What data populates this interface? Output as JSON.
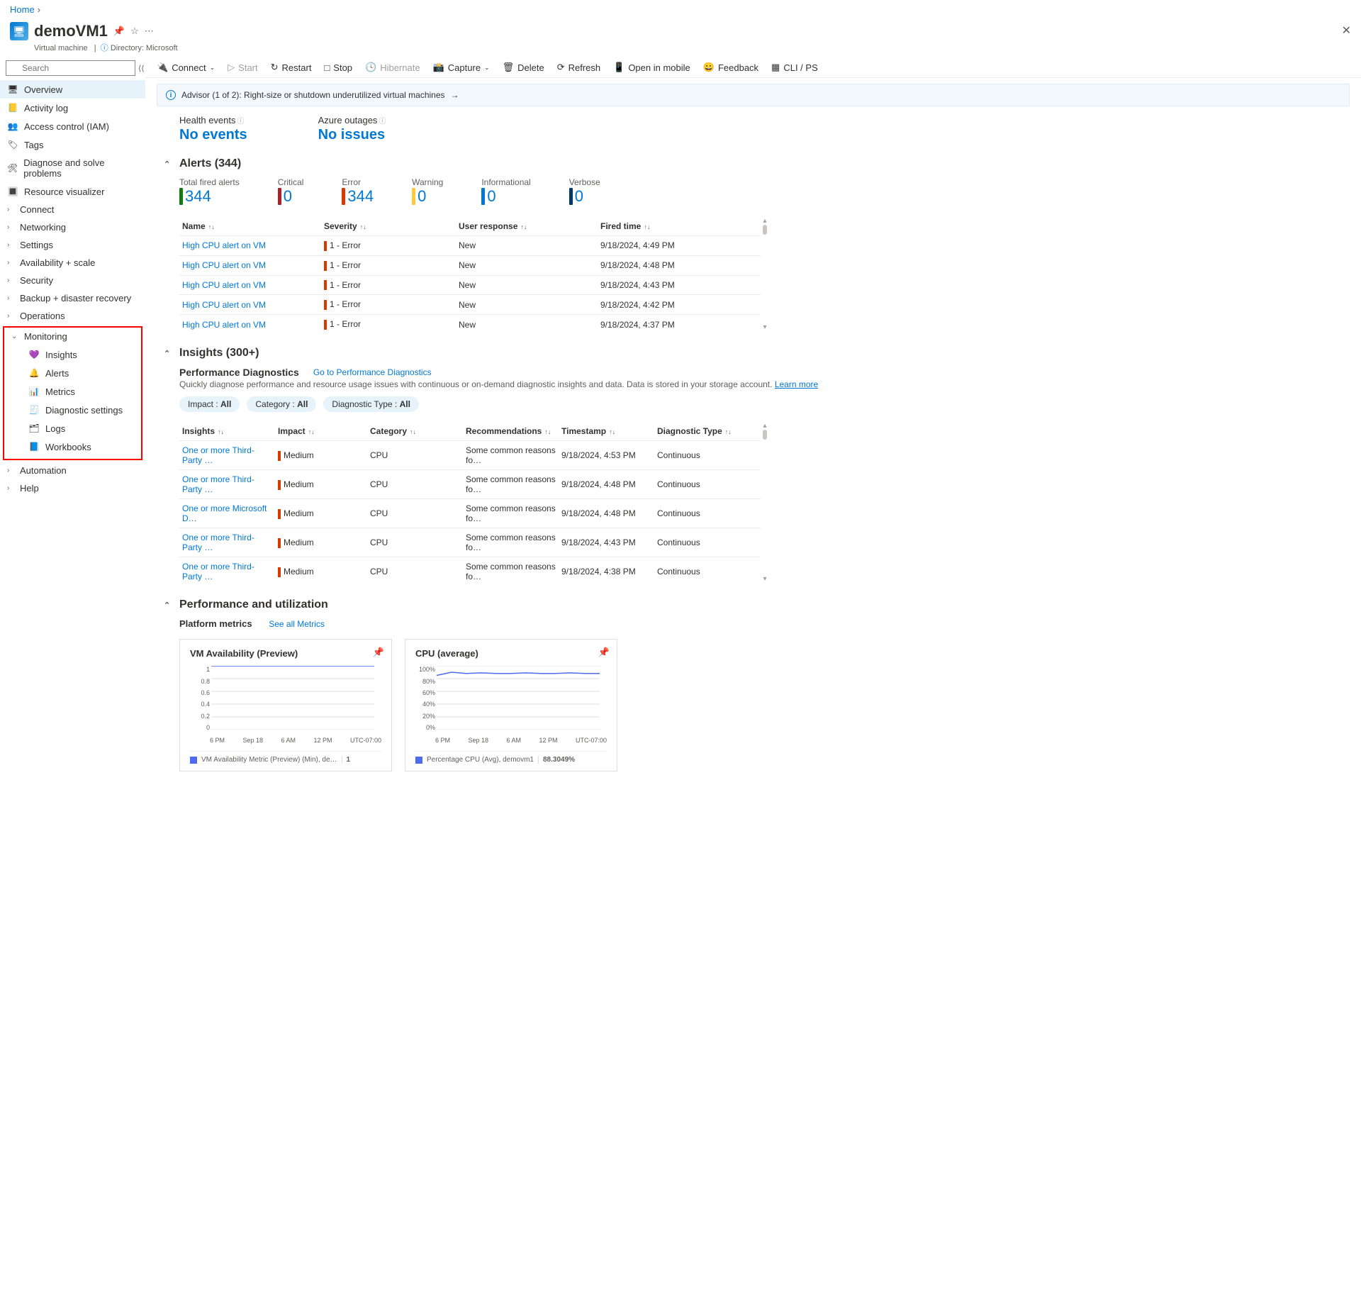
{
  "breadcrumb": {
    "home": "Home"
  },
  "header": {
    "title": "demoVM1",
    "subtitle": "Virtual machine",
    "directory_label": "Directory: Microsoft"
  },
  "sidebar": {
    "search_placeholder": "Search",
    "items_top": [
      {
        "label": "Overview",
        "selected": true,
        "icon": "🖥"
      },
      {
        "label": "Activity log",
        "icon": "📒"
      },
      {
        "label": "Access control (IAM)",
        "icon": "👥"
      },
      {
        "label": "Tags",
        "icon": "🏷"
      },
      {
        "label": "Diagnose and solve problems",
        "icon": "🛠"
      },
      {
        "label": "Resource visualizer",
        "icon": "🔳"
      }
    ],
    "items_chev": [
      {
        "label": "Connect"
      },
      {
        "label": "Networking"
      },
      {
        "label": "Settings"
      },
      {
        "label": "Availability + scale"
      },
      {
        "label": "Security"
      },
      {
        "label": "Backup + disaster recovery"
      },
      {
        "label": "Operations"
      }
    ],
    "monitoring_label": "Monitoring",
    "monitoring_items": [
      {
        "label": "Insights",
        "icon": "💜"
      },
      {
        "label": "Alerts",
        "icon": "🔔"
      },
      {
        "label": "Metrics",
        "icon": "📊"
      },
      {
        "label": "Diagnostic settings",
        "icon": "🧾"
      },
      {
        "label": "Logs",
        "icon": "🗂"
      },
      {
        "label": "Workbooks",
        "icon": "📘"
      }
    ],
    "automation": "Automation",
    "help": "Help"
  },
  "toolbar": {
    "connect": "Connect",
    "start": "Start",
    "restart": "Restart",
    "stop": "Stop",
    "hibernate": "Hibernate",
    "capture": "Capture",
    "delete": "Delete",
    "refresh": "Refresh",
    "open_mobile": "Open in mobile",
    "feedback": "Feedback",
    "cli": "CLI / PS"
  },
  "advisor": "Advisor (1 of 2): Right-size or shutdown underutilized virtual machines",
  "health": {
    "events_label": "Health events",
    "events_value": "No events",
    "azure_label": "Azure outages",
    "azure_value": "No issues"
  },
  "alerts": {
    "header": "Alerts (344)",
    "summary": [
      {
        "label": "Total fired alerts",
        "value": "344",
        "cls": "total"
      },
      {
        "label": "Critical",
        "value": "0",
        "cls": "crit"
      },
      {
        "label": "Error",
        "value": "344",
        "cls": "err"
      },
      {
        "label": "Warning",
        "value": "0",
        "cls": "warn"
      },
      {
        "label": "Informational",
        "value": "0",
        "cls": "info"
      },
      {
        "label": "Verbose",
        "value": "0",
        "cls": "verb"
      }
    ],
    "cols": {
      "name": "Name",
      "severity": "Severity",
      "user": "User response",
      "time": "Fired time"
    },
    "rows": [
      {
        "name": "High CPU alert on VM",
        "sev": "1 - Error",
        "user": "New",
        "time": "9/18/2024, 4:49 PM"
      },
      {
        "name": "High CPU alert on VM",
        "sev": "1 - Error",
        "user": "New",
        "time": "9/18/2024, 4:48 PM"
      },
      {
        "name": "High CPU alert on VM",
        "sev": "1 - Error",
        "user": "New",
        "time": "9/18/2024, 4:43 PM"
      },
      {
        "name": "High CPU alert on VM",
        "sev": "1 - Error",
        "user": "New",
        "time": "9/18/2024, 4:42 PM"
      },
      {
        "name": "High CPU alert on VM",
        "sev": "1 - Error",
        "user": "New",
        "time": "9/18/2024, 4:37 PM"
      }
    ]
  },
  "insights": {
    "header": "Insights (300+)",
    "perf_title": "Performance Diagnostics",
    "perf_link": "Go to Performance Diagnostics",
    "perf_desc": "Quickly diagnose performance and resource usage issues with continuous or on-demand diagnostic insights and data. Data is stored in your storage account.",
    "learn_more": "Learn more",
    "pills": [
      {
        "prefix": "Impact : ",
        "val": "All"
      },
      {
        "prefix": "Category : ",
        "val": "All"
      },
      {
        "prefix": "Diagnostic Type : ",
        "val": "All"
      }
    ],
    "cols": {
      "insights": "Insights",
      "impact": "Impact",
      "category": "Category",
      "rec": "Recommendations",
      "ts": "Timestamp",
      "dtype": "Diagnostic Type"
    },
    "rows": [
      {
        "ins": "One or more Third-Party …",
        "imp": "Medium",
        "cat": "CPU",
        "rec": "Some common reasons fo…",
        "ts": "9/18/2024, 4:53 PM",
        "dt": "Continuous"
      },
      {
        "ins": "One or more Third-Party …",
        "imp": "Medium",
        "cat": "CPU",
        "rec": "Some common reasons fo…",
        "ts": "9/18/2024, 4:48 PM",
        "dt": "Continuous"
      },
      {
        "ins": "One or more Microsoft D…",
        "imp": "Medium",
        "cat": "CPU",
        "rec": "Some common reasons fo…",
        "ts": "9/18/2024, 4:48 PM",
        "dt": "Continuous"
      },
      {
        "ins": "One or more Third-Party …",
        "imp": "Medium",
        "cat": "CPU",
        "rec": "Some common reasons fo…",
        "ts": "9/18/2024, 4:43 PM",
        "dt": "Continuous"
      },
      {
        "ins": "One or more Third-Party …",
        "imp": "Medium",
        "cat": "CPU",
        "rec": "Some common reasons fo…",
        "ts": "9/18/2024, 4:38 PM",
        "dt": "Continuous"
      }
    ]
  },
  "perf": {
    "header": "Performance and utilization",
    "platform": "Platform metrics",
    "see_all": "See all Metrics"
  },
  "chart_data": [
    {
      "type": "line",
      "title": "VM Availability (Preview)",
      "y_ticks": [
        "1",
        "0.8",
        "0.6",
        "0.4",
        "0.2",
        "0"
      ],
      "x_ticks": [
        "6 PM",
        "Sep 18",
        "6 AM",
        "12 PM",
        "UTC-07:00"
      ],
      "series": [
        {
          "name": "VM Availability Metric (Preview) (Min), de…",
          "value_label": "1",
          "values": [
            1,
            1,
            1,
            1,
            1,
            1,
            1,
            1,
            1,
            1,
            1,
            1
          ]
        }
      ],
      "ylim": [
        0,
        1
      ]
    },
    {
      "type": "line",
      "title": "CPU (average)",
      "y_ticks": [
        "100%",
        "80%",
        "60%",
        "40%",
        "20%",
        "0%"
      ],
      "x_ticks": [
        "6 PM",
        "Sep 18",
        "6 AM",
        "12 PM",
        "UTC-07:00"
      ],
      "series": [
        {
          "name": "Percentage CPU (Avg), demovm1",
          "value_label": "88.3049%",
          "values": [
            85,
            90,
            88,
            89,
            88,
            88,
            89,
            88,
            88,
            89,
            88,
            88
          ]
        }
      ],
      "ylim": [
        0,
        100
      ]
    }
  ]
}
